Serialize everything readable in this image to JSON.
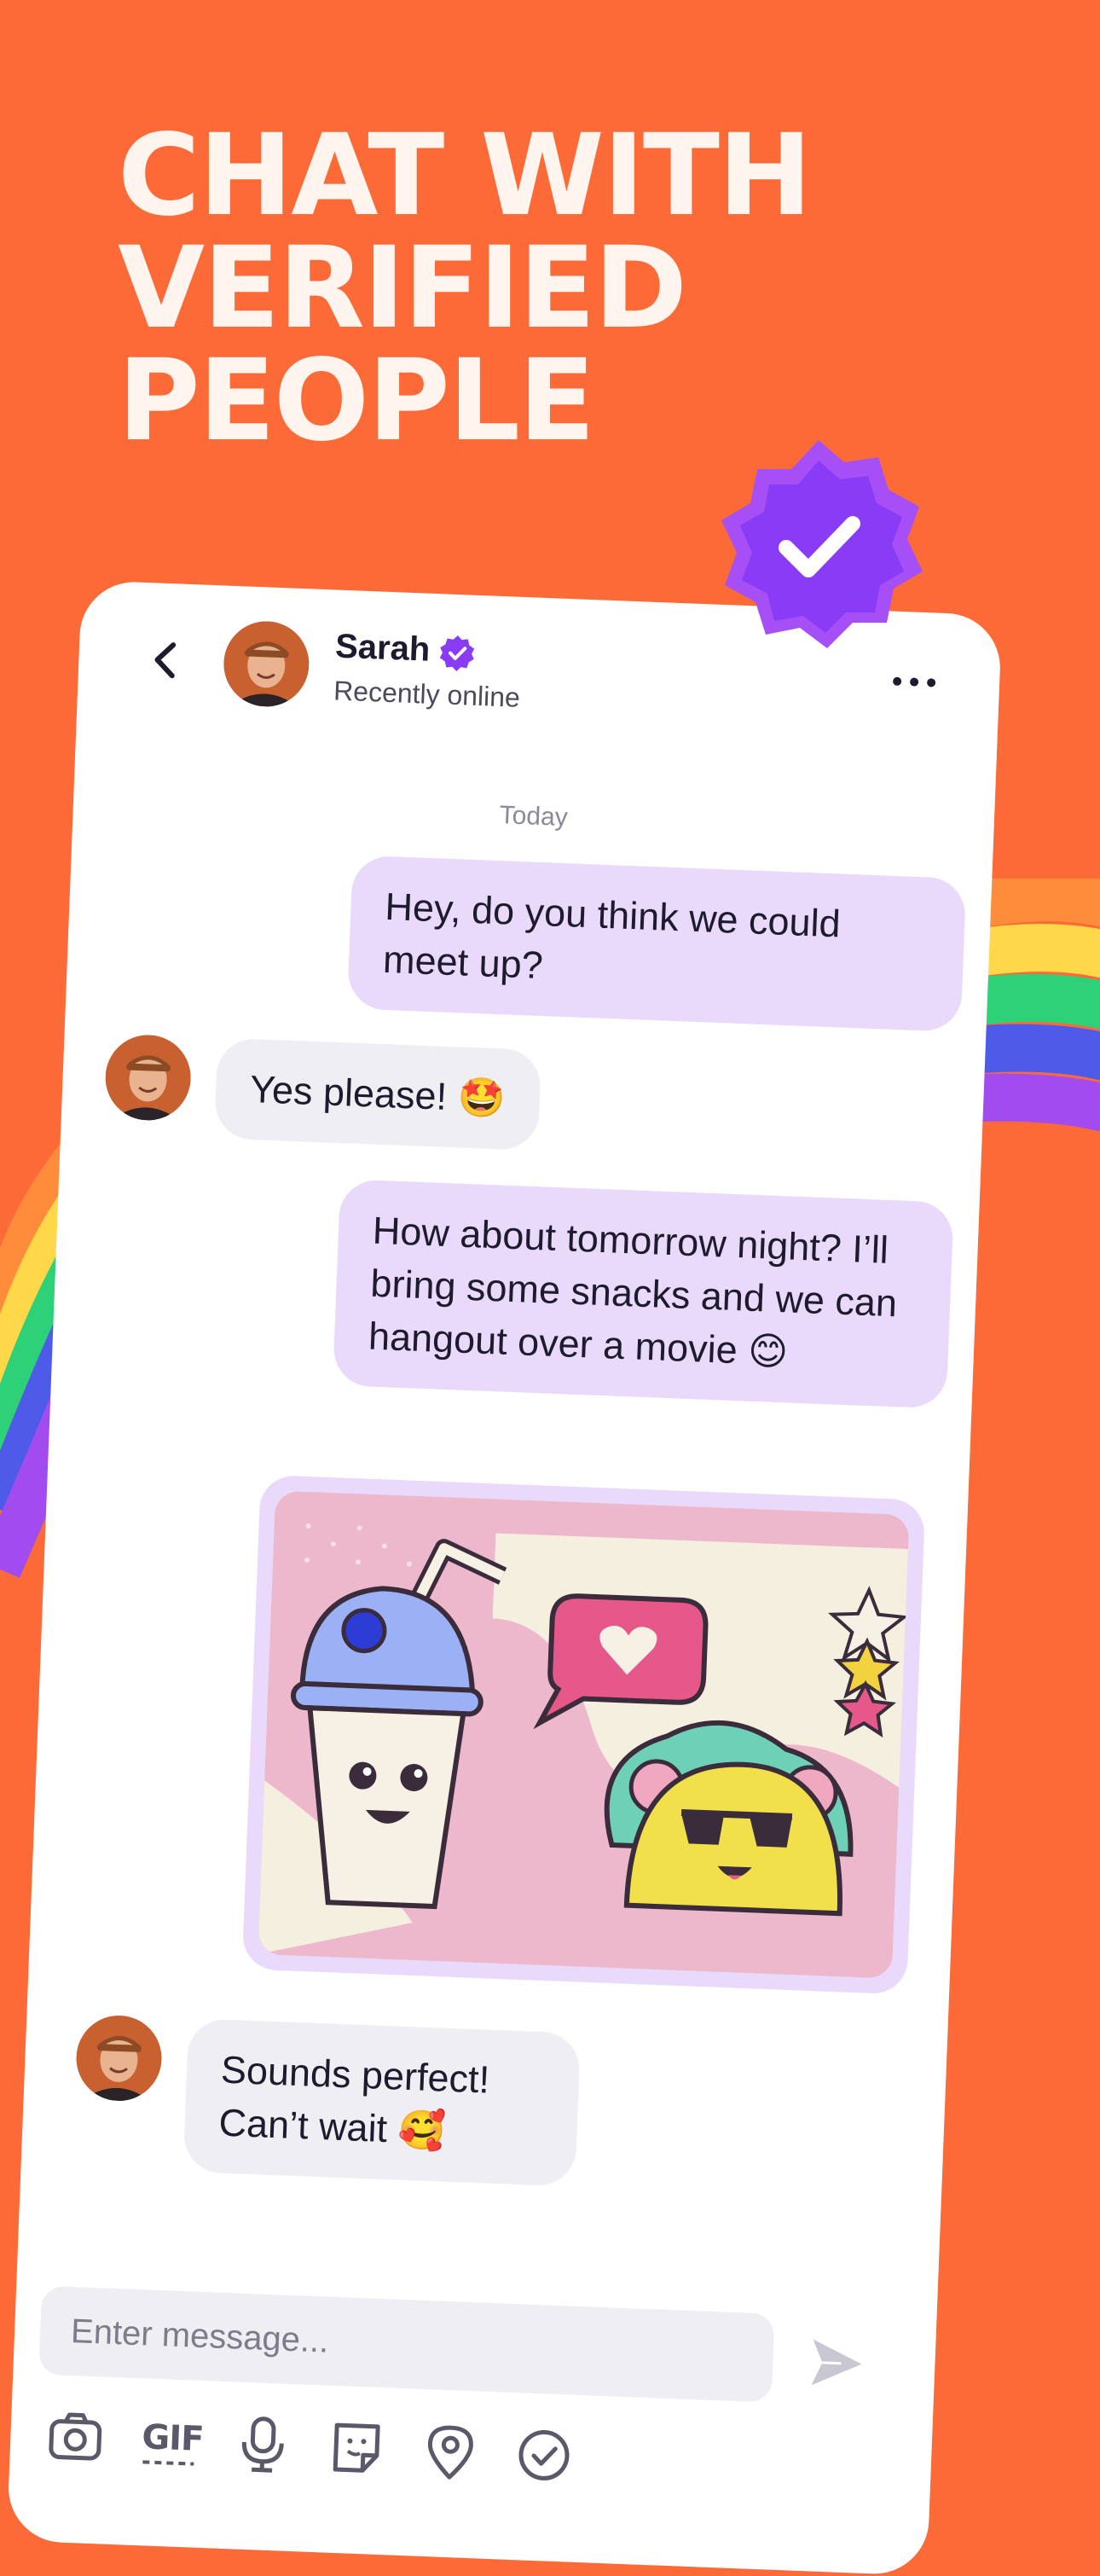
{
  "promo": {
    "headline_lines": [
      "CHAT WITH",
      "VERIFIED",
      "PEOPLE"
    ]
  },
  "colors": {
    "background": "#FC6A37",
    "bubble_outgoing": "#E9DAFB",
    "bubble_incoming": "#EFEEF2",
    "verified_purple": "#8A3BF5"
  },
  "chat": {
    "header": {
      "back_icon": "chevron-left-icon",
      "contact_name": "Sarah",
      "verified_icon": "verified-badge-icon",
      "status": "Recently online",
      "more_icon": "more-horizontal-icon"
    },
    "day_separator": "Today",
    "messages": [
      {
        "direction": "outgoing",
        "text": "Hey, do you think we could meet up?"
      },
      {
        "direction": "incoming",
        "text": "Yes please!",
        "emoji": "🤩"
      },
      {
        "direction": "outgoing",
        "text": "How about tomorrow night? I’ll bring some snacks and we can hangout over a movie",
        "emoji": "😊"
      },
      {
        "direction": "outgoing",
        "type": "sticker",
        "description": "drink-and-taco-sticker"
      },
      {
        "direction": "incoming",
        "text": "Sounds perfect! Can’t wait",
        "emoji": "🥰"
      }
    ],
    "composer": {
      "placeholder": "Enter message...",
      "send_icon": "send-icon"
    },
    "toolbar": [
      {
        "icon": "camera-icon"
      },
      {
        "icon": "gif-icon",
        "label": "GIF"
      },
      {
        "icon": "microphone-icon"
      },
      {
        "icon": "sticker-icon"
      },
      {
        "icon": "location-pin-icon"
      },
      {
        "icon": "check-circle-icon"
      }
    ]
  }
}
